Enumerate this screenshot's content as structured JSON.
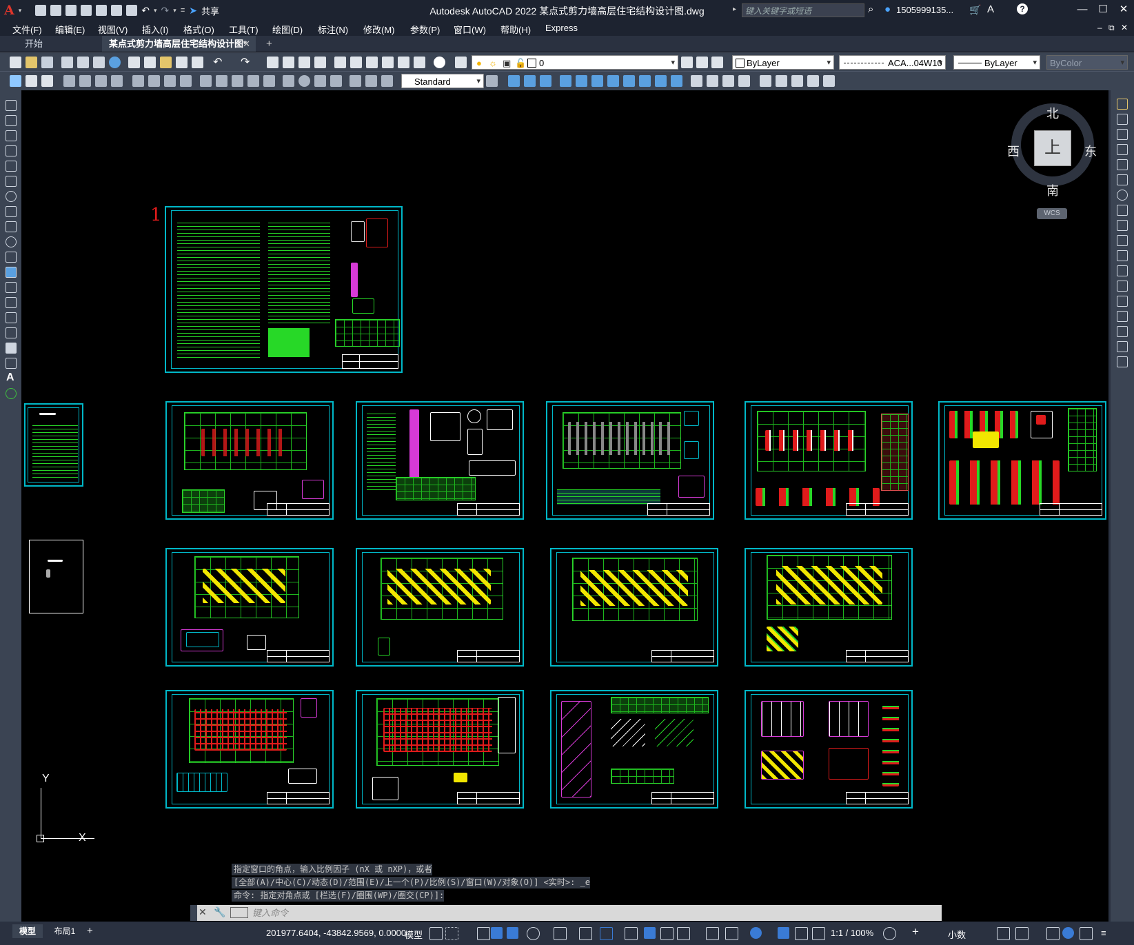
{
  "app": {
    "logo": "A",
    "title": "Autodesk AutoCAD 2022    某点式剪力墙高层住宅结构设计图.dwg",
    "share_label": "共享"
  },
  "search": {
    "placeholder": "键入关键字或短语"
  },
  "user": {
    "name": "1505999135..."
  },
  "menu": [
    "文件(F)",
    "编辑(E)",
    "视图(V)",
    "插入(I)",
    "格式(O)",
    "工具(T)",
    "绘图(D)",
    "标注(N)",
    "修改(M)",
    "参数(P)",
    "窗口(W)",
    "帮助(H)",
    "Express"
  ],
  "tabs": {
    "start": "开始",
    "document": "某点式剪力墙高层住宅结构设计图*"
  },
  "toolbar": {
    "layer_value": "0",
    "color_value": "ByLayer",
    "linetype_value": "ACA...04W10",
    "lineweight_value": "ByLayer",
    "plotstyle_value": "ByColor",
    "textstyle_value": "Standard"
  },
  "viewcube": {
    "face": "上",
    "north": "北",
    "south": "南",
    "west": "西",
    "east": "东",
    "wcs": "WCS"
  },
  "drawing": {
    "sheet_number": "1"
  },
  "ucs": {
    "x": "X",
    "y": "Y"
  },
  "command": {
    "history": [
      "指定窗口的角点，输入比例因子 (nX 或 nXP)，或者",
      "[全部(A)/中心(C)/动态(D)/范围(E)/上一个(P)/比例(S)/窗口(W)/对象(O)] <实时>: _e",
      "命令: 指定对角点或 [栏选(F)/圈围(WP)/圈交(CP)]:"
    ],
    "placeholder": "键入命令"
  },
  "status": {
    "layout_tabs": [
      "模型",
      "布局1"
    ],
    "coordinates": "201977.6404, -43842.9569, 0.0000",
    "model_label": "模型",
    "scale": "1:1 / 100%",
    "units": "小数"
  },
  "colors": {
    "accent_cyan": "#00b8c8",
    "drawing_green": "#1db51d",
    "drawing_yellow": "#f2e600",
    "drawing_red": "#e01b1b",
    "drawing_magenta": "#d63ad6"
  }
}
